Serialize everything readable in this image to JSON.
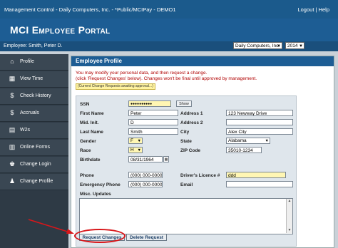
{
  "topbar": {
    "breadcrumb": "Management Control - Daily Computers, Inc. - *Public/MCIPay - DEMO1",
    "logout": "Logout",
    "separator": "|",
    "help": "Help"
  },
  "header": {
    "title": "MCI Employee Portal",
    "company_select": "Daily Computers, Inc.",
    "year_select": "2014"
  },
  "employee_bar": {
    "label": "Employee: Smith, Peter D."
  },
  "sidebar": {
    "items": [
      {
        "label": "Profile",
        "icon": "home-icon"
      },
      {
        "label": "View Time",
        "icon": "calendar-icon"
      },
      {
        "label": "Check History",
        "icon": "money-bag-icon"
      },
      {
        "label": "Accruals",
        "icon": "money-bag-icon"
      },
      {
        "label": "W2s",
        "icon": "document-icon"
      },
      {
        "label": "Online Forms",
        "icon": "forms-icon"
      },
      {
        "label": "Change Login",
        "icon": "key-user-icon"
      },
      {
        "label": "Change Profile",
        "icon": "user-icon"
      }
    ]
  },
  "profile": {
    "section_title": "Employee Profile",
    "notice_line1": "You may modify your personal data, and then request a change.",
    "notice_line2": "(click 'Request Changes' below). Changes won't be final until approved by management.",
    "pending_note": "(Current Change Requests awaiting approval...)",
    "labels": {
      "ssn": "SSN",
      "first_name": "First Name",
      "mid_init": "Mid. Init.",
      "last_name": "Last Name",
      "gender": "Gender",
      "race": "Race",
      "birthdate": "Birthdate",
      "address1": "Address 1",
      "address2": "Address 2",
      "city": "City",
      "state": "State",
      "zip": "ZIP Code",
      "phone": "Phone",
      "emergency_phone": "Emergency Phone",
      "drivers_licence": "Driver's Licence #",
      "email": "Email",
      "misc_updates": "Misc. Updates"
    },
    "values": {
      "ssn": "●●●●●●●●●●",
      "show_button": "Show",
      "first_name": "Peter",
      "mid_init": "D",
      "last_name": "Smith",
      "gender": "F",
      "race": "H",
      "birthdate": "08/31/1964",
      "address1": "123 Newway Drive",
      "address2": "",
      "city": "Alex City",
      "state": "Alabama",
      "zip": "35010-1234",
      "phone": "(000) 000-0000",
      "emergency_phone": "(000) 000-0000",
      "drivers_licence": "ddd",
      "email": "",
      "misc_updates": ""
    },
    "buttons": {
      "request_changes": "Request Changes",
      "delete_request": "Delete Request"
    }
  },
  "colors": {
    "header_blue": "#1d5d94",
    "sidebar_dark": "#2e3a45",
    "notice_red": "#b00000",
    "highlight_red": "#d8161a",
    "field_yellow": "#fff6b3"
  }
}
